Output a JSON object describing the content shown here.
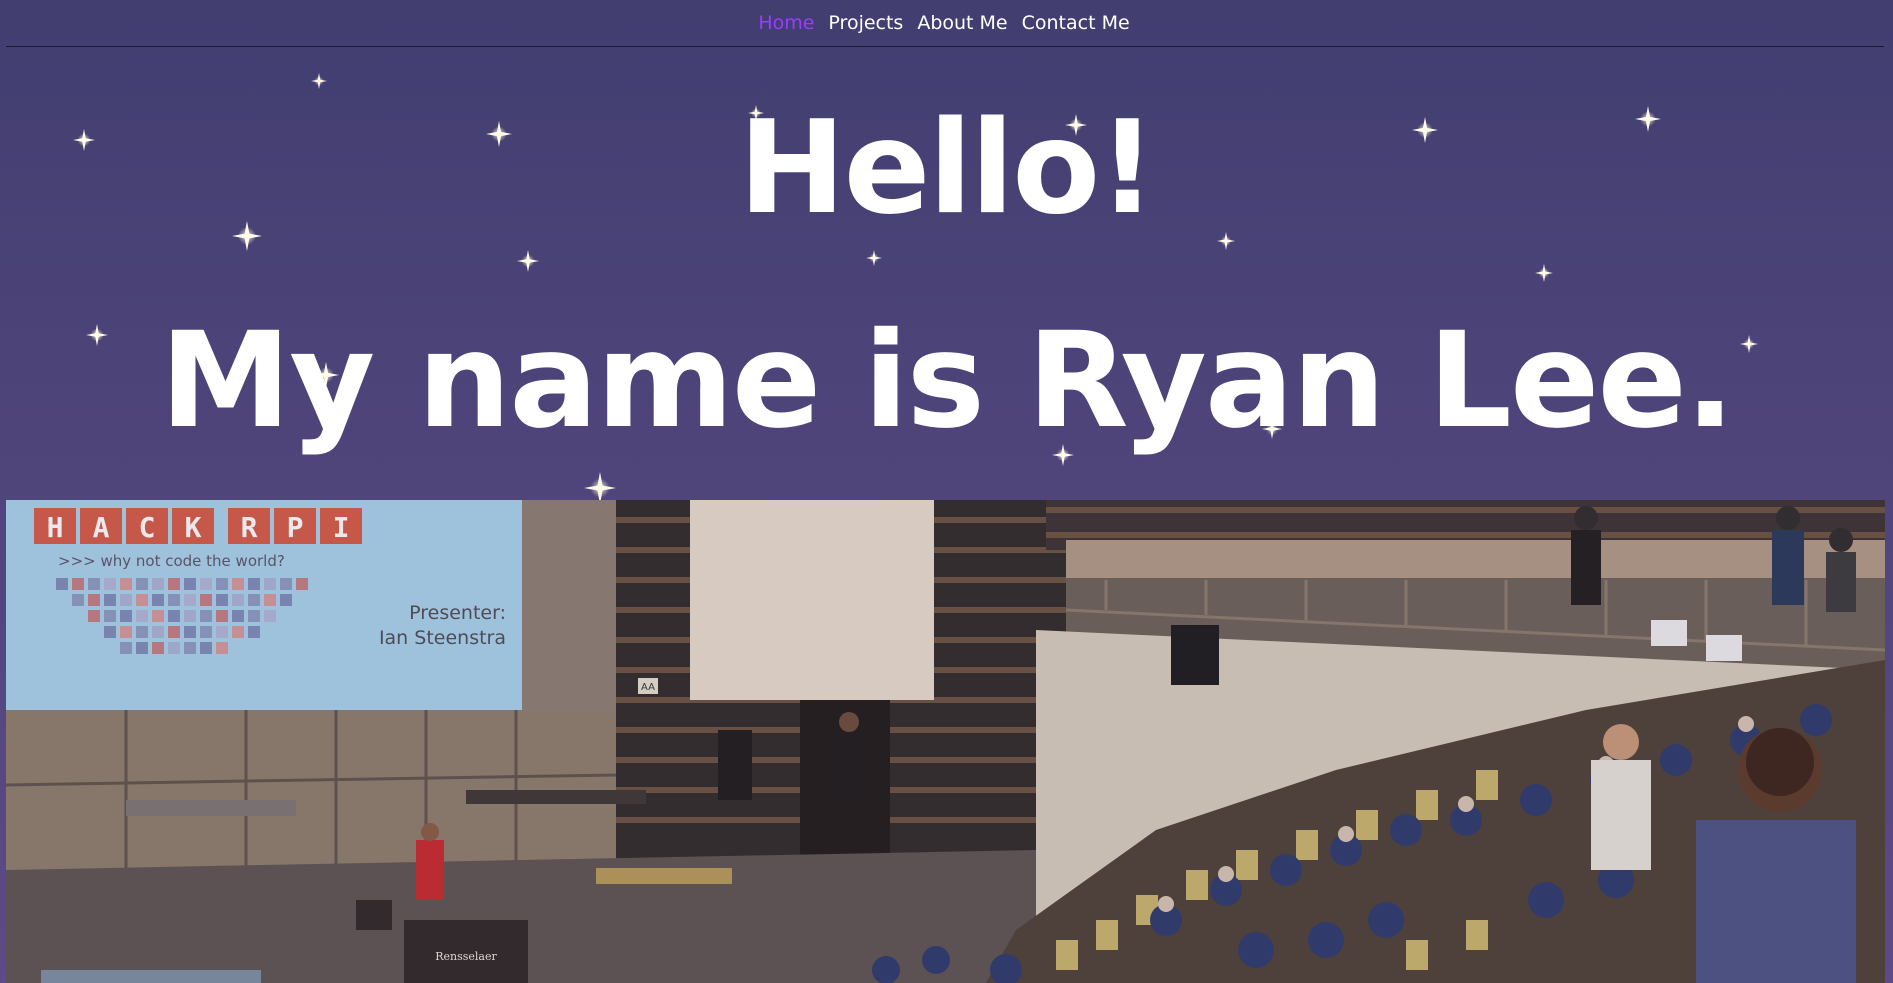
{
  "nav": {
    "items": [
      {
        "label": "Home",
        "active": true
      },
      {
        "label": "Projects",
        "active": false
      },
      {
        "label": "About Me",
        "active": false
      },
      {
        "label": "Contact Me",
        "active": false
      }
    ],
    "active_color": "#9a3cff"
  },
  "hero": {
    "greeting": "Hello!",
    "intro": "My name is Ryan Lee."
  },
  "photo": {
    "slide_title_letters": [
      "H",
      "A",
      "C",
      "K",
      "R",
      "P",
      "I"
    ],
    "slide_tagline": ">>> why not code the world?",
    "slide_presenter_label": "Presenter:",
    "slide_presenter_name": "Ian Steenstra",
    "podium_label": "Rensselaer",
    "sign_label": "AA"
  },
  "colors": {
    "background_top": "#423e70",
    "background_bottom": "#5d4a86",
    "text": "#ffffff"
  }
}
